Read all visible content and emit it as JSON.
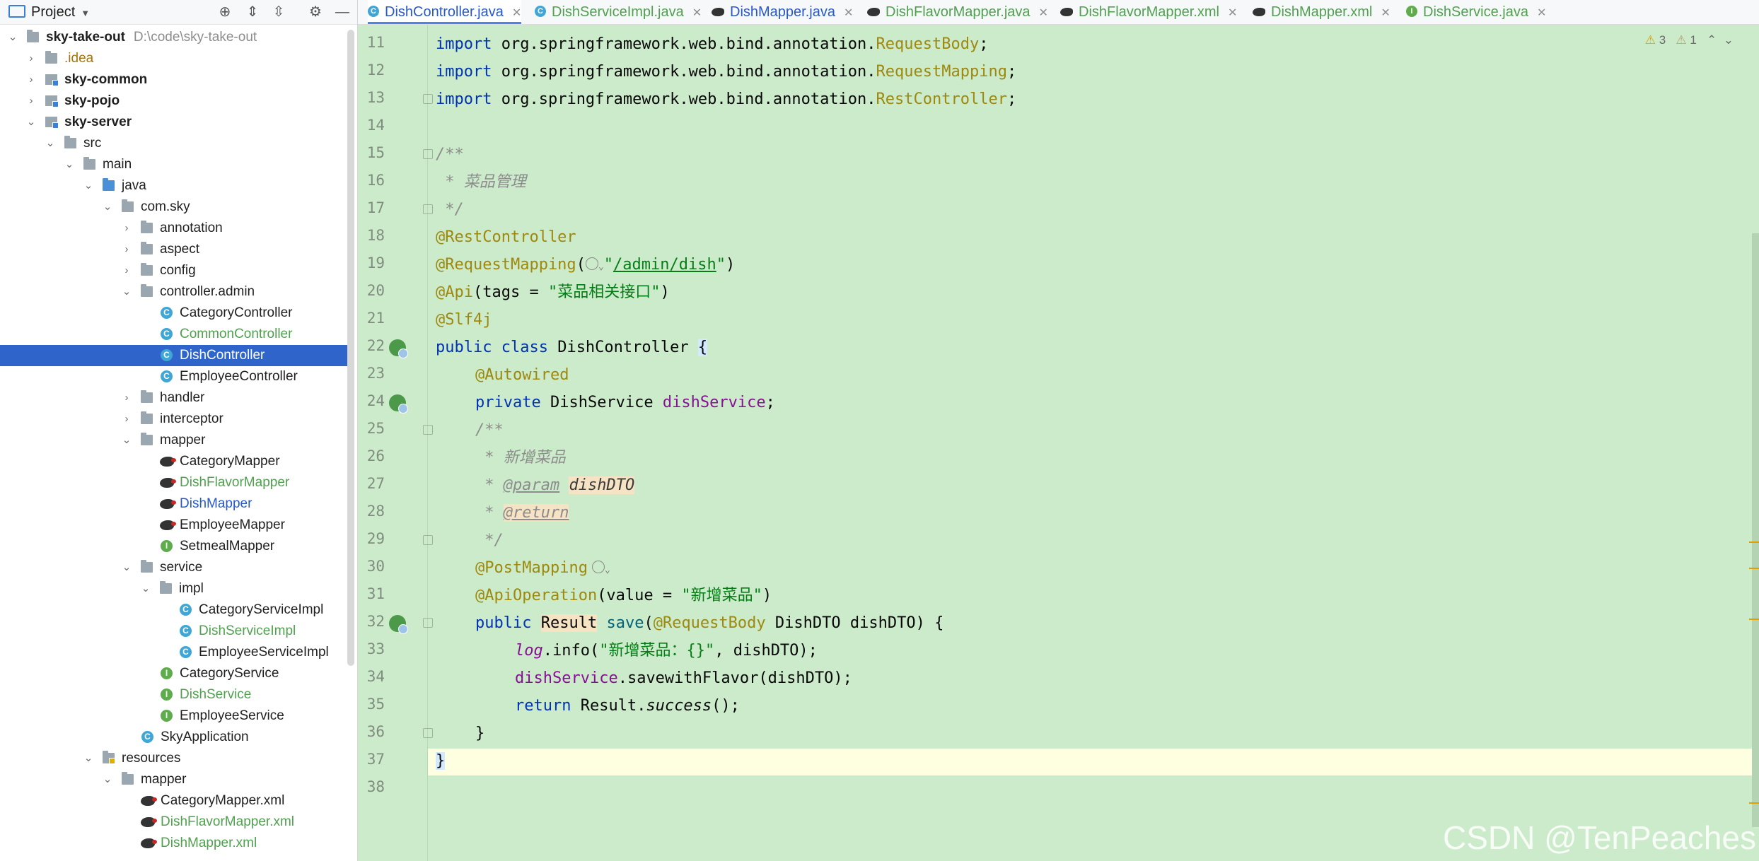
{
  "project_panel": {
    "title": "Project",
    "tree": [
      {
        "label": "sky-take-out",
        "path": "D:\\code\\sky-take-out"
      },
      {
        "label": ".idea"
      },
      {
        "label": "sky-common"
      },
      {
        "label": "sky-pojo"
      },
      {
        "label": "sky-server"
      },
      {
        "label": "src"
      },
      {
        "label": "main"
      },
      {
        "label": "java"
      },
      {
        "label": "com.sky"
      },
      {
        "label": "annotation"
      },
      {
        "label": "aspect"
      },
      {
        "label": "config"
      },
      {
        "label": "controller.admin"
      },
      {
        "label": "CategoryController"
      },
      {
        "label": "CommonController"
      },
      {
        "label": "DishController"
      },
      {
        "label": "EmployeeController"
      },
      {
        "label": "handler"
      },
      {
        "label": "interceptor"
      },
      {
        "label": "mapper"
      },
      {
        "label": "CategoryMapper"
      },
      {
        "label": "DishFlavorMapper"
      },
      {
        "label": "DishMapper"
      },
      {
        "label": "EmployeeMapper"
      },
      {
        "label": "SetmealMapper"
      },
      {
        "label": "service"
      },
      {
        "label": "impl"
      },
      {
        "label": "CategoryServiceImpl"
      },
      {
        "label": "DishServiceImpl"
      },
      {
        "label": "EmployeeServiceImpl"
      },
      {
        "label": "CategoryService"
      },
      {
        "label": "DishService"
      },
      {
        "label": "EmployeeService"
      },
      {
        "label": "SkyApplication"
      },
      {
        "label": "resources"
      },
      {
        "label": "mapper"
      },
      {
        "label": "CategoryMapper.xml"
      },
      {
        "label": "DishFlavorMapper.xml"
      },
      {
        "label": "DishMapper.xml"
      }
    ]
  },
  "tabs": [
    {
      "label": "DishController.java"
    },
    {
      "label": "DishServiceImpl.java"
    },
    {
      "label": "DishMapper.java"
    },
    {
      "label": "DishFlavorMapper.java"
    },
    {
      "label": "DishFlavorMapper.xml"
    },
    {
      "label": "DishMapper.xml"
    },
    {
      "label": "DishService.java"
    }
  ],
  "editor": {
    "warnings": {
      "warning_count": "3",
      "weak_warning_count": "1"
    },
    "line_numbers": [
      "11",
      "12",
      "13",
      "14",
      "15",
      "16",
      "17",
      "18",
      "19",
      "20",
      "21",
      "22",
      "23",
      "24",
      "25",
      "26",
      "27",
      "28",
      "29",
      "30",
      "31",
      "32",
      "33",
      "34",
      "35",
      "36",
      "37",
      "38"
    ],
    "code": {
      "l11_kw": "import",
      "l11_pkg": " org.springframework.web.bind.annotation.",
      "l11_cls": "RequestBody",
      "l11_end": ";",
      "l12_kw": "import",
      "l12_pkg": " org.springframework.web.bind.annotation.",
      "l12_cls": "RequestMapping",
      "l12_end": ";",
      "l13_kw": "import",
      "l13_pkg": " org.springframework.web.bind.annotation.",
      "l13_cls": "RestController",
      "l13_end": ";",
      "l15": "/**",
      "l16": " * 菜品管理",
      "l17": " */",
      "l18": "@RestController",
      "l19_ann": "@RequestMapping",
      "l19_open": "(",
      "l19_q1": "\"",
      "l19_url": "/admin/dish",
      "l19_q2": "\"",
      "l19_close": ")",
      "l20_ann": "@Api",
      "l20_mid": "(tags = ",
      "l20_str": "\"菜品相关接口\"",
      "l20_close": ")",
      "l21": "@Slf4j",
      "l22_kw": "public class",
      "l22_name": " DishController ",
      "l22_brace": "{",
      "l23": "@Autowired",
      "l24_kw": "private",
      "l24_type": " DishService ",
      "l24_fld": "dishService",
      "l24_end": ";",
      "l25": "/**",
      "l26": " * 新增菜品",
      "l27_star": " * ",
      "l27_tag": "@param",
      "l27_sp": " ",
      "l27_name": "dishDTO",
      "l28_star": " * ",
      "l28_tag": "@return",
      "l29": " */",
      "l30": "@PostMapping",
      "l31_ann": "@ApiOperation",
      "l31_mid": "(value = ",
      "l31_str": "\"新增菜品\"",
      "l31_close": ")",
      "l32_kw": "public",
      "l32_sp": " ",
      "l32_type": "Result",
      "l32_sp2": " ",
      "l32_m": "save",
      "l32_open": "(",
      "l32_ann": "@RequestBody",
      "l32_rest": " DishDTO dishDTO) {",
      "l33_log": "log",
      "l33_call": ".info(",
      "l33_str": "\"新增菜品：{}\"",
      "l33_rest": ", dishDTO);",
      "l34_fld": "dishService",
      "l34_rest": ".savewithFlavor(dishDTO);",
      "l35_kw": "return",
      "l35_cls": " Result.",
      "l35_m": "success",
      "l35_end": "();",
      "l36": "}",
      "l37": "}"
    }
  },
  "watermark": "CSDN @TenPeaches"
}
